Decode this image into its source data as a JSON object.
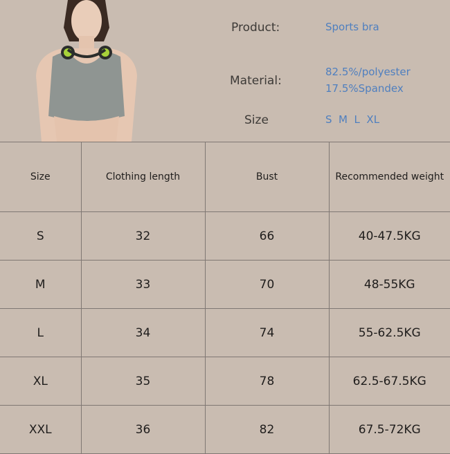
{
  "product_info": {
    "product_label": "Product:",
    "product_value": "Sports bra",
    "material_label": "Material:",
    "material_line1": "82.5%/polyester",
    "material_line2": "17.5%Spandex",
    "size_label": "Size",
    "size_value": "S  M  L  XL"
  },
  "table": {
    "headers": [
      "Size",
      "Clothing length",
      "Bust",
      "Recommended weight"
    ],
    "rows": [
      [
        "S",
        "32",
        "66",
        "40-47.5KG"
      ],
      [
        "M",
        "33",
        "70",
        "48-55KG"
      ],
      [
        "L",
        "34",
        "74",
        "55-62.5KG"
      ],
      [
        "XL",
        "35",
        "78",
        "62.5-67.5KG"
      ],
      [
        "XXL",
        "36",
        "82",
        "67.5-72KG"
      ]
    ]
  },
  "colors": {
    "background": "#c9bcb1",
    "label_text": "#3d3a37",
    "value_text": "#4f7fbf",
    "grid_line": "#7f7773"
  }
}
